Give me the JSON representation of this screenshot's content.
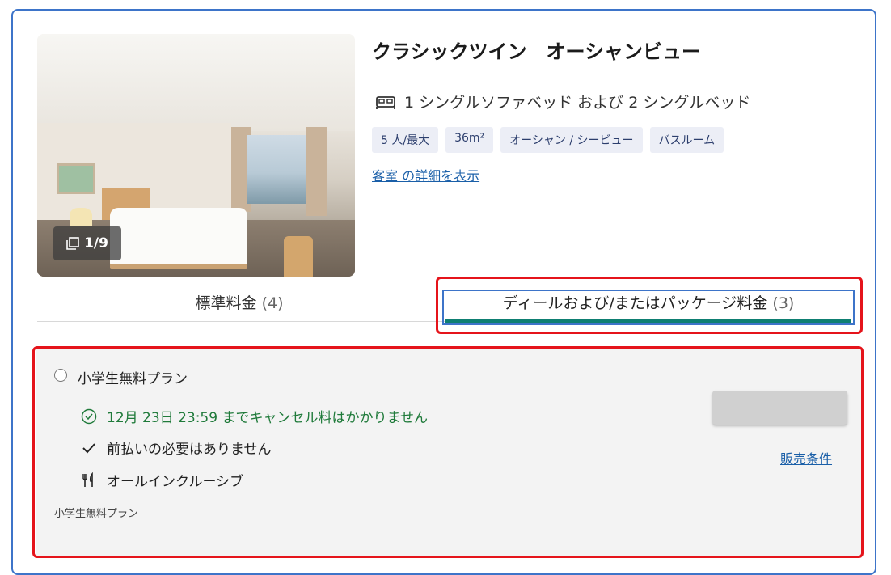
{
  "room": {
    "title": "クラシックツイン　オーシャンビュー",
    "beds": "1 シングルソファベッド および 2 シングルベッド",
    "tags": [
      "5 人/最大",
      "36m²",
      "オーシャン / シービュー",
      "バスルーム"
    ],
    "details_link": "客室 の詳細を表示",
    "photo_counter": "1/9"
  },
  "tabs": {
    "standard": {
      "label": "標準料金",
      "count": "(4)"
    },
    "deals": {
      "label": "ディールおよび/またはパッケージ料金",
      "count": "(3)"
    }
  },
  "plan": {
    "title": "小学生無料プラン",
    "cancellation": "12月 23日 23:59 までキャンセル料はかかりません",
    "prepayment": "前払いの必要はありません",
    "meal": "オールインクルーシブ",
    "subtitle": "小学生無料プラン",
    "terms_link": "販売条件"
  },
  "colors": {
    "accent_blue": "#3d74c9",
    "link": "#1a5fa8",
    "tab_underline": "#0e7f72",
    "cancel_green": "#1f7a3a",
    "highlight_red": "#e5141b"
  }
}
